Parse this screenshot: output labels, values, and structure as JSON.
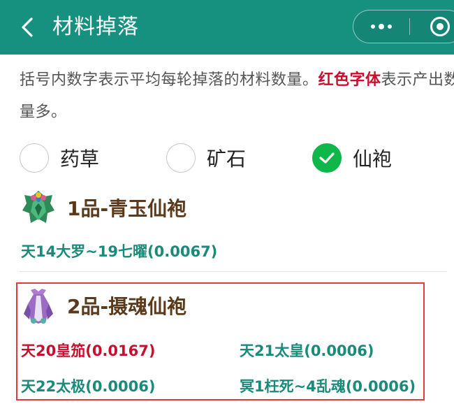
{
  "header": {
    "title": "材料掉落",
    "back_icon": "chevron-left-icon",
    "more_icon": "more-dots-icon",
    "close_icon": "target-circle-icon",
    "bg_color": "#17917f"
  },
  "description": {
    "prefix": "括号内数字表示平均每轮掉落的材料数量。",
    "highlight": "红色字体",
    "suffix": "表示产出数量多。",
    "highlight_color": "#c8102e"
  },
  "filters": [
    {
      "label": "药草",
      "checked": false
    },
    {
      "label": "矿石",
      "checked": false
    },
    {
      "label": "仙袍",
      "checked": true
    }
  ],
  "items": [
    {
      "name": "1品-青玉仙袍",
      "icon": "jade-robe-icon",
      "drops": [
        {
          "text": "天14大罗~19七曜(0.0067)",
          "hot": false
        }
      ]
    },
    {
      "name": "2品-摄魂仙袍",
      "icon": "soul-robe-icon",
      "drops": [
        {
          "text": "天20皇笳(0.0167)",
          "hot": true
        },
        {
          "text": "天21太皇(0.0006)",
          "hot": false
        },
        {
          "text": "天22太极(0.0006)",
          "hot": false
        },
        {
          "text": "冥1枉死~4乱魂(0.0006)",
          "hot": false
        }
      ]
    }
  ]
}
